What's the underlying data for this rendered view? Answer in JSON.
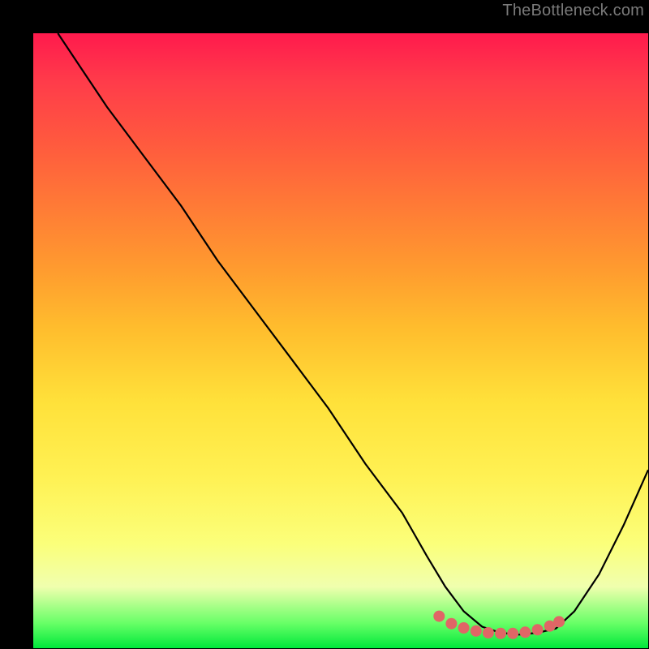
{
  "watermark": "TheBottleneck.com",
  "chart_data": {
    "type": "line",
    "title": "",
    "xlabel": "",
    "ylabel": "",
    "xlim": [
      0,
      100
    ],
    "ylim": [
      0,
      100
    ],
    "series": [
      {
        "name": "bottleneck-curve",
        "x": [
          4,
          8,
          12,
          18,
          24,
          30,
          36,
          42,
          48,
          54,
          60,
          64,
          67,
          70,
          73,
          76,
          79,
          82,
          85,
          88,
          92,
          96,
          100
        ],
        "values": [
          100,
          94,
          88,
          80,
          72,
          63,
          55,
          47,
          39,
          30,
          22,
          15,
          10,
          6,
          3.5,
          2.5,
          2.2,
          2.5,
          3.2,
          6,
          12,
          20,
          29
        ]
      }
    ],
    "marker_region": {
      "name": "optimal-zone-dots",
      "x": [
        66,
        68,
        70,
        72,
        74,
        76,
        78,
        80,
        82,
        84,
        85.5
      ],
      "values": [
        5.2,
        4.0,
        3.3,
        2.8,
        2.5,
        2.4,
        2.4,
        2.6,
        3.0,
        3.6,
        4.3
      ]
    },
    "colors": {
      "curve": "#000000",
      "markers": "#e06666",
      "gradient_top": "#ff1a4d",
      "gradient_bottom": "#00e83b"
    }
  }
}
